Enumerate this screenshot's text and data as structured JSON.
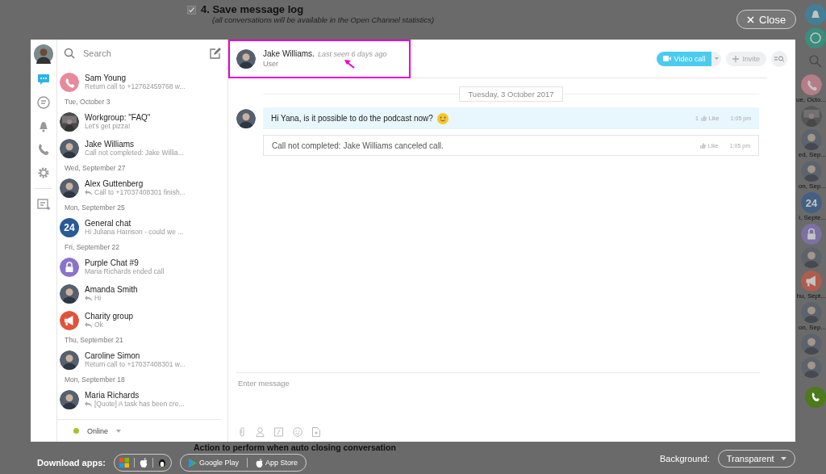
{
  "background": {
    "checked": true,
    "heading": "4. Save message log",
    "note": "(all conversations will be available in the Open Channel statistics)",
    "bottom_heading": "Action to perform when auto closing conversation",
    "download_label": "Download apps:",
    "stores": [
      {
        "kind": "google",
        "label": "Google Play"
      },
      {
        "kind": "apple",
        "label": "App Store"
      }
    ],
    "background_label": "Background:",
    "background_value": "Transparent",
    "close": "Close",
    "strip": [
      {
        "kind": "phone",
        "label": "ue, Octo..."
      },
      {
        "kind": "group"
      },
      {
        "kind": "person",
        "label": "ed, Sep..."
      },
      {
        "kind": "person",
        "label": "on, Sep..."
      },
      {
        "kind": "number",
        "text": "24",
        "label": "i, Septe..."
      },
      {
        "kind": "lock"
      },
      {
        "kind": "person"
      },
      {
        "kind": "megaphone",
        "label": "hu, Sept..."
      },
      {
        "kind": "person",
        "label": "on, Sep..."
      },
      {
        "kind": "person"
      },
      {
        "kind": "person"
      }
    ]
  },
  "rail": [
    {
      "kind": "chat",
      "selected": true
    },
    {
      "kind": "search-chat",
      "selected": false
    },
    {
      "kind": "bell",
      "selected": false
    },
    {
      "kind": "phone",
      "selected": false
    },
    {
      "kind": "gear",
      "selected": false
    },
    {
      "kind": "notes",
      "selected": false
    }
  ],
  "search": {
    "placeholder": "Search"
  },
  "chats": [
    {
      "kind": "chat",
      "name": "Sam Young",
      "preview": "Return call to +12762459768 w...",
      "avatar": {
        "kind": "phone"
      },
      "reply": false
    },
    {
      "kind": "date",
      "text": "Tue, October 3"
    },
    {
      "kind": "chat",
      "name": "Workgroup: \"FAQ\"",
      "preview": "Let's get pizza!",
      "avatar": {
        "kind": "group"
      },
      "reply": false
    },
    {
      "kind": "chat",
      "name": "Jake Williams",
      "preview": "Call not completed: Jake Willia...",
      "avatar": {
        "kind": "person"
      },
      "reply": false
    },
    {
      "kind": "date",
      "text": "Wed, September 27"
    },
    {
      "kind": "chat",
      "name": "Alex Guttenberg",
      "preview": "Call to +17037408301 finish...",
      "avatar": {
        "kind": "person"
      },
      "reply": true
    },
    {
      "kind": "date",
      "text": "Mon, September 25"
    },
    {
      "kind": "chat",
      "name": "General chat",
      "preview": "Hi Juliana Harrison - could we ...",
      "avatar": {
        "kind": "number",
        "text": "24"
      },
      "reply": false
    },
    {
      "kind": "date",
      "text": "Fri, September 22"
    },
    {
      "kind": "chat",
      "name": "Purple Chat #9",
      "preview": "Maria Richards ended call",
      "avatar": {
        "kind": "lock"
      },
      "reply": false
    },
    {
      "kind": "chat",
      "name": "Amanda Smith",
      "preview": "Hi",
      "avatar": {
        "kind": "person"
      },
      "reply": true
    },
    {
      "kind": "chat",
      "name": "Charity group",
      "preview": "Ok",
      "avatar": {
        "kind": "megaphone"
      },
      "reply": true
    },
    {
      "kind": "date",
      "text": "Thu, September 21"
    },
    {
      "kind": "chat",
      "name": "Caroline Simon",
      "preview": "Return call to +17037408301 w...",
      "avatar": {
        "kind": "person"
      },
      "reply": false
    },
    {
      "kind": "date",
      "text": "Mon, September 18"
    },
    {
      "kind": "chat",
      "name": "Maria Richards",
      "preview": "[Quote] A task has been cre...",
      "avatar": {
        "kind": "person"
      },
      "reply": true
    }
  ],
  "status": {
    "label": "Online",
    "color": "#a3c52b"
  },
  "header": {
    "name": "Jake Williams.",
    "last_seen": "Last seen 6 days ago",
    "role": "User",
    "video_call": "Video call",
    "invite": "Invite"
  },
  "date_divider": "Tuesday, 3 October 2017",
  "messages": [
    {
      "kind": "incoming",
      "text": "Hi Yana, is it possible to do the podcast now?",
      "likes": "1",
      "like": "Like",
      "time": "1:05 pm"
    },
    {
      "kind": "system",
      "text": "Call not completed: Jake Williams canceled call.",
      "like": "Like",
      "time": "1:05 pm"
    }
  ],
  "composer": {
    "placeholder": "Enter message"
  }
}
